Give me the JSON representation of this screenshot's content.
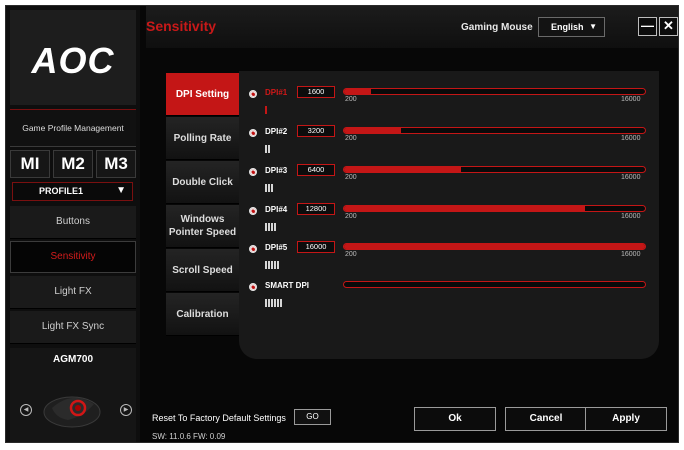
{
  "app": {
    "title": "Sensitivity",
    "device": "Gaming Mouse",
    "language": "English",
    "minimize_glyph": "—",
    "close_glyph": "✕"
  },
  "sidebar": {
    "logo": "AOC",
    "game_profile_label": "Game Profile Management",
    "modes": [
      "MI",
      "M2",
      "M3"
    ],
    "profile": "PROFILE1",
    "nav": [
      {
        "label": "Buttons"
      },
      {
        "label": "Sensitivity",
        "active": true
      },
      {
        "label": "Light FX"
      },
      {
        "label": "Light FX Sync"
      }
    ],
    "mouse_model": "AGM700"
  },
  "tabs": [
    {
      "label": "DPI Setting",
      "active": true
    },
    {
      "label": "Polling Rate"
    },
    {
      "label": "Double Click"
    },
    {
      "label": "Windows Pointer Speed"
    },
    {
      "label": "Scroll Speed"
    },
    {
      "label": "Calibration"
    }
  ],
  "dpi": {
    "min": 200,
    "max": 16000,
    "min_label": "200",
    "max_label": "16000",
    "rows": [
      {
        "label": "DPI#1",
        "value": "1600",
        "level": 1,
        "active": true,
        "fill": 0.09
      },
      {
        "label": "DPI#2",
        "value": "3200",
        "level": 2,
        "fill": 0.19
      },
      {
        "label": "DPI#3",
        "value": "6400",
        "level": 3,
        "fill": 0.39
      },
      {
        "label": "DPI#4",
        "value": "12800",
        "level": 4,
        "fill": 0.8
      },
      {
        "label": "DPI#5",
        "value": "16000",
        "level": 5,
        "fill": 1.0
      },
      {
        "label": "SMART DPI",
        "value": "",
        "level": 6,
        "fill": 0
      }
    ]
  },
  "footer": {
    "reset_label": "Reset To Factory Default Settings",
    "go_label": "GO",
    "version": "SW: 11.0.6   FW: 0.09",
    "ok_label": "Ok",
    "cancel_label": "Cancel",
    "apply_label": "Apply"
  },
  "colors": {
    "accent": "#c41616"
  }
}
